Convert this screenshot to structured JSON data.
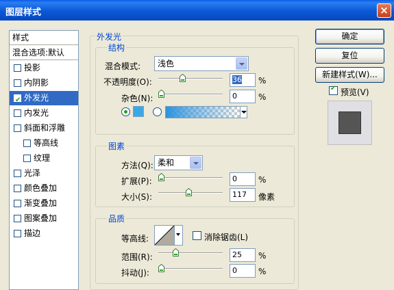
{
  "window": {
    "title": "图层样式",
    "close_label": "×"
  },
  "left_list": {
    "header": "样式",
    "blend_options": "混合选项:默认",
    "items": [
      {
        "label": "投影",
        "checked": false,
        "selected": false,
        "indent": false
      },
      {
        "label": "内阴影",
        "checked": false,
        "selected": false,
        "indent": false
      },
      {
        "label": "外发光",
        "checked": true,
        "selected": true,
        "indent": false
      },
      {
        "label": "内发光",
        "checked": false,
        "selected": false,
        "indent": false
      },
      {
        "label": "斜面和浮雕",
        "checked": false,
        "selected": false,
        "indent": false
      },
      {
        "label": "等高线",
        "checked": false,
        "selected": false,
        "indent": true
      },
      {
        "label": "纹理",
        "checked": false,
        "selected": false,
        "indent": true
      },
      {
        "label": "光泽",
        "checked": false,
        "selected": false,
        "indent": false
      },
      {
        "label": "颜色叠加",
        "checked": false,
        "selected": false,
        "indent": false
      },
      {
        "label": "渐变叠加",
        "checked": false,
        "selected": false,
        "indent": false
      },
      {
        "label": "图案叠加",
        "checked": false,
        "selected": false,
        "indent": false
      },
      {
        "label": "描边",
        "checked": false,
        "selected": false,
        "indent": false
      }
    ]
  },
  "outer_glow": {
    "section_title": "外发光",
    "structure": {
      "title": "结构",
      "blend_mode_label": "混合模式:",
      "blend_mode_value": "浅色",
      "opacity_label": "不透明度(O):",
      "opacity_value": "36",
      "opacity_unit": "%",
      "noise_label": "杂色(N):",
      "noise_value": "0",
      "noise_unit": "%",
      "color_swatch": "#3aa8e8"
    },
    "elements": {
      "title": "图素",
      "technique_label": "方法(Q):",
      "technique_value": "柔和",
      "spread_label": "扩展(P):",
      "spread_value": "0",
      "spread_unit": "%",
      "size_label": "大小(S):",
      "size_value": "117",
      "size_unit": "像素"
    },
    "quality": {
      "title": "品质",
      "contour_label": "等高线:",
      "antialias_label": "消除锯齿(L)",
      "range_label": "范围(R):",
      "range_value": "25",
      "range_unit": "%",
      "jitter_label": "抖动(J):",
      "jitter_value": "0",
      "jitter_unit": "%"
    }
  },
  "buttons": {
    "ok": "确定",
    "reset": "复位",
    "new_style": "新建样式(W)...",
    "preview_label": "预览(V)",
    "preview_checked": true
  },
  "slider_levels": {
    "opacity": 0.36,
    "noise": 0.0,
    "spread": 0.0,
    "size": 0.47,
    "range": 0.25,
    "jitter": 0.0
  }
}
